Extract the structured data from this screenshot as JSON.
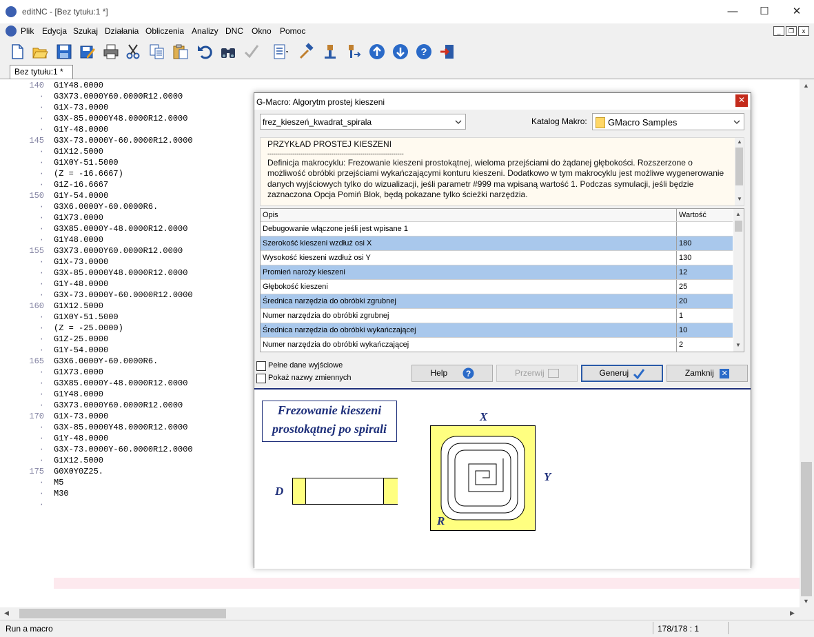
{
  "window": {
    "title": "editNC - [Bez tytułu:1 *]",
    "min": "—",
    "max": "☐",
    "close": "✕"
  },
  "menu": [
    "Plik",
    "Edycja",
    "Szukaj",
    "Działania",
    "Obliczenia",
    "Analizy",
    "DNC",
    "Okno",
    "Pomoc"
  ],
  "mdi_controls": [
    "_",
    "❐",
    "x"
  ],
  "tab": {
    "label": "Bez tytułu:1 *"
  },
  "editor": {
    "lines": [
      {
        "n": "140",
        "t": "G1Y48.0000"
      },
      {
        "n": "·",
        "t": "G3X73.0000Y60.0000R12.0000"
      },
      {
        "n": "·",
        "t": "G1X-73.0000"
      },
      {
        "n": "·",
        "t": "G3X-85.0000Y48.0000R12.0000"
      },
      {
        "n": "·",
        "t": "G1Y-48.0000"
      },
      {
        "n": "145",
        "t": "G3X-73.0000Y-60.0000R12.0000"
      },
      {
        "n": "·",
        "t": "G1X12.5000"
      },
      {
        "n": "·",
        "t": "G1X0Y-51.5000"
      },
      {
        "n": "·",
        "t": "(Z = -16.6667)"
      },
      {
        "n": "·",
        "t": "G1Z-16.6667"
      },
      {
        "n": "150",
        "t": "G1Y-54.0000"
      },
      {
        "n": "·",
        "t": "G3X6.0000Y-60.0000R6."
      },
      {
        "n": "·",
        "t": "G1X73.0000"
      },
      {
        "n": "·",
        "t": "G3X85.0000Y-48.0000R12.0000"
      },
      {
        "n": "·",
        "t": "G1Y48.0000"
      },
      {
        "n": "155",
        "t": "G3X73.0000Y60.0000R12.0000"
      },
      {
        "n": "·",
        "t": "G1X-73.0000"
      },
      {
        "n": "·",
        "t": "G3X-85.0000Y48.0000R12.0000"
      },
      {
        "n": "·",
        "t": "G1Y-48.0000"
      },
      {
        "n": "·",
        "t": "G3X-73.0000Y-60.0000R12.0000"
      },
      {
        "n": "160",
        "t": "G1X12.5000"
      },
      {
        "n": "·",
        "t": "G1X0Y-51.5000"
      },
      {
        "n": "·",
        "t": "(Z = -25.0000)"
      },
      {
        "n": "·",
        "t": "G1Z-25.0000"
      },
      {
        "n": "·",
        "t": "G1Y-54.0000"
      },
      {
        "n": "165",
        "t": "G3X6.0000Y-60.0000R6."
      },
      {
        "n": "·",
        "t": "G1X73.0000"
      },
      {
        "n": "·",
        "t": "G3X85.0000Y-48.0000R12.0000"
      },
      {
        "n": "·",
        "t": "G1Y48.0000"
      },
      {
        "n": "·",
        "t": "G3X73.0000Y60.0000R12.0000"
      },
      {
        "n": "170",
        "t": "G1X-73.0000"
      },
      {
        "n": "·",
        "t": "G3X-85.0000Y48.0000R12.0000"
      },
      {
        "n": "·",
        "t": "G1Y-48.0000"
      },
      {
        "n": "·",
        "t": "G3X-73.0000Y-60.0000R12.0000"
      },
      {
        "n": "·",
        "t": "G1X12.5000"
      },
      {
        "n": "175",
        "t": "G0X0Y0Z25."
      },
      {
        "n": "·",
        "t": "M5"
      },
      {
        "n": "·",
        "t": "M30"
      },
      {
        "n": "·",
        "t": ""
      }
    ]
  },
  "status": {
    "message": "Run a macro",
    "position": "178/178 : 1"
  },
  "dialog": {
    "title": "G-Macro:  Algorytm prostej kieszeni",
    "macro_select": "frez_kieszeń_kwadrat_spirala",
    "catalog_label": "Katalog Makro:",
    "catalog_value": "GMacro Samples",
    "desc_heading": "PRZYKŁAD PROSTEJ KIESZENI",
    "desc_rule": "------------------------------------------------------------------",
    "desc_body": "Definicja makrocyklu: Frezowanie kieszeni prostokątnej, wieloma przejściami do żądanej głębokości. Rozszerzone o możliwość obróbki przejściami wykańczającymi konturu kieszeni. Dodatkowo w tym makrocyklu jest możliwe wygenerowanie danych wyjściowych tylko do wizualizacji, jeśli parametr #999 ma wpisaną wartość 1. Podczas symulacji, jeśli będzie zaznaczona Opcja Pomiń Blok, będą pokazane tylko ścieżki narzędzia.",
    "grid_headers": {
      "opis": "Opis",
      "wartosc": "Wartość"
    },
    "params": [
      {
        "opis": "Debugowanie włączone jeśli jest wpisane 1",
        "wartosc": ""
      },
      {
        "opis": "Szerokość kieszeni wzdłuż osi X",
        "wartosc": "180"
      },
      {
        "opis": "Wysokość kieszeni wzdłuż osi Y",
        "wartosc": "130"
      },
      {
        "opis": "Promień naroży kieszeni",
        "wartosc": "12"
      },
      {
        "opis": "Głębokość kieszeni",
        "wartosc": "25"
      },
      {
        "opis": "Średnica narzędzia do obróbki zgrubnej",
        "wartosc": "20"
      },
      {
        "opis": "Numer narzędzia do obróbki zgrubnej",
        "wartosc": "1"
      },
      {
        "opis": "Średnica narzędzia do obróbki wykańczającej",
        "wartosc": "10"
      },
      {
        "opis": "Numer narzędzia do obróbki wykańczającej",
        "wartosc": "2"
      }
    ],
    "chk_full": "Pełne dane wyjściowe",
    "chk_names": "Pokaż nazwy zmiennych",
    "btn_help": "Help",
    "btn_break": "Przerwij",
    "btn_generate": "Generuj",
    "btn_close": "Zamknij",
    "preview": {
      "title_line1": "Frezowanie kieszeni",
      "title_line2": "prostokątnej po spirali",
      "label_d": "D",
      "label_x": "X",
      "label_y": "Y",
      "label_r": "R"
    }
  },
  "colors": {
    "highlight_row": "#a9c8ec",
    "preview_fill": "#ffff80",
    "preview_text": "#1e2f7a",
    "current_line": "#fde9ee"
  }
}
